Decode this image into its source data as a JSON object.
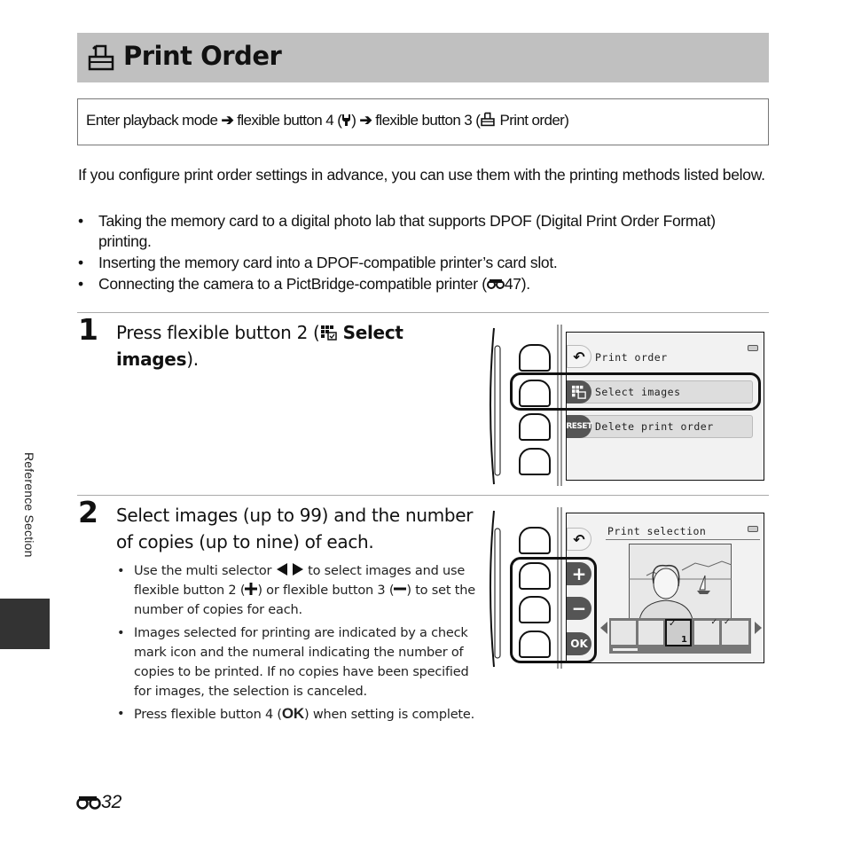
{
  "header": {
    "title": "Print Order",
    "icon": "print-order-icon"
  },
  "nav_path": {
    "parts": [
      "Enter playback mode",
      "flexible button 4 (",
      ") ",
      "flexible button 3 (",
      " Print order)"
    ],
    "arrow": "➔",
    "icons": [
      "wrench-icon",
      "print-order-icon"
    ]
  },
  "intro": {
    "text": "If you configure print order settings in advance, you can use them with the printing methods listed below.",
    "bullets": [
      "Taking the memory card to a digital photo lab that supports DPOF (Digital Print Order Format) printing.",
      "Inserting the memory card into a DPOF-compatible printer’s card slot.",
      "Connecting the camera to a PictBridge-compatible printer (",
      "47)."
    ],
    "ref_icon": "reference-icon"
  },
  "step1": {
    "number": "1",
    "text_pre": "Press flexible button 2 (",
    "bold": "Select images",
    "text_post": ").",
    "screen": {
      "title": "Print order",
      "items": [
        {
          "icon": "select-images-icon",
          "label": "Select images",
          "highlighted": true
        },
        {
          "icon": "reset-icon",
          "icon_text": "RESET",
          "label": "Delete print order",
          "highlighted": false
        }
      ]
    }
  },
  "step2": {
    "number": "2",
    "heading": "Select images (up to 99) and the number of copies (up to nine) of each.",
    "bullets": [
      {
        "pre": "Use the multi selector ",
        "mid1": " to select images and use flexible button 2 (",
        "mid2": ") or flexible button 3 (",
        "post": ") to set the number of copies for each."
      },
      {
        "text": "Images selected for printing are indicated by a check mark icon and the numeral indicating the number of copies to be printed. If no copies have been specified for images, the selection is canceled."
      },
      {
        "pre": "Press flexible button 4 (",
        "ok": "OK",
        "post": ") when setting is complete."
      }
    ],
    "screen": {
      "title": "Print selection",
      "buttons": [
        "+",
        "−",
        "OK"
      ],
      "thumbnails": 5,
      "selected_thumbnail": 3,
      "copies_on_selected": "1"
    }
  },
  "side_tab": {
    "label": "Reference Section"
  },
  "footer": {
    "page": "32"
  }
}
